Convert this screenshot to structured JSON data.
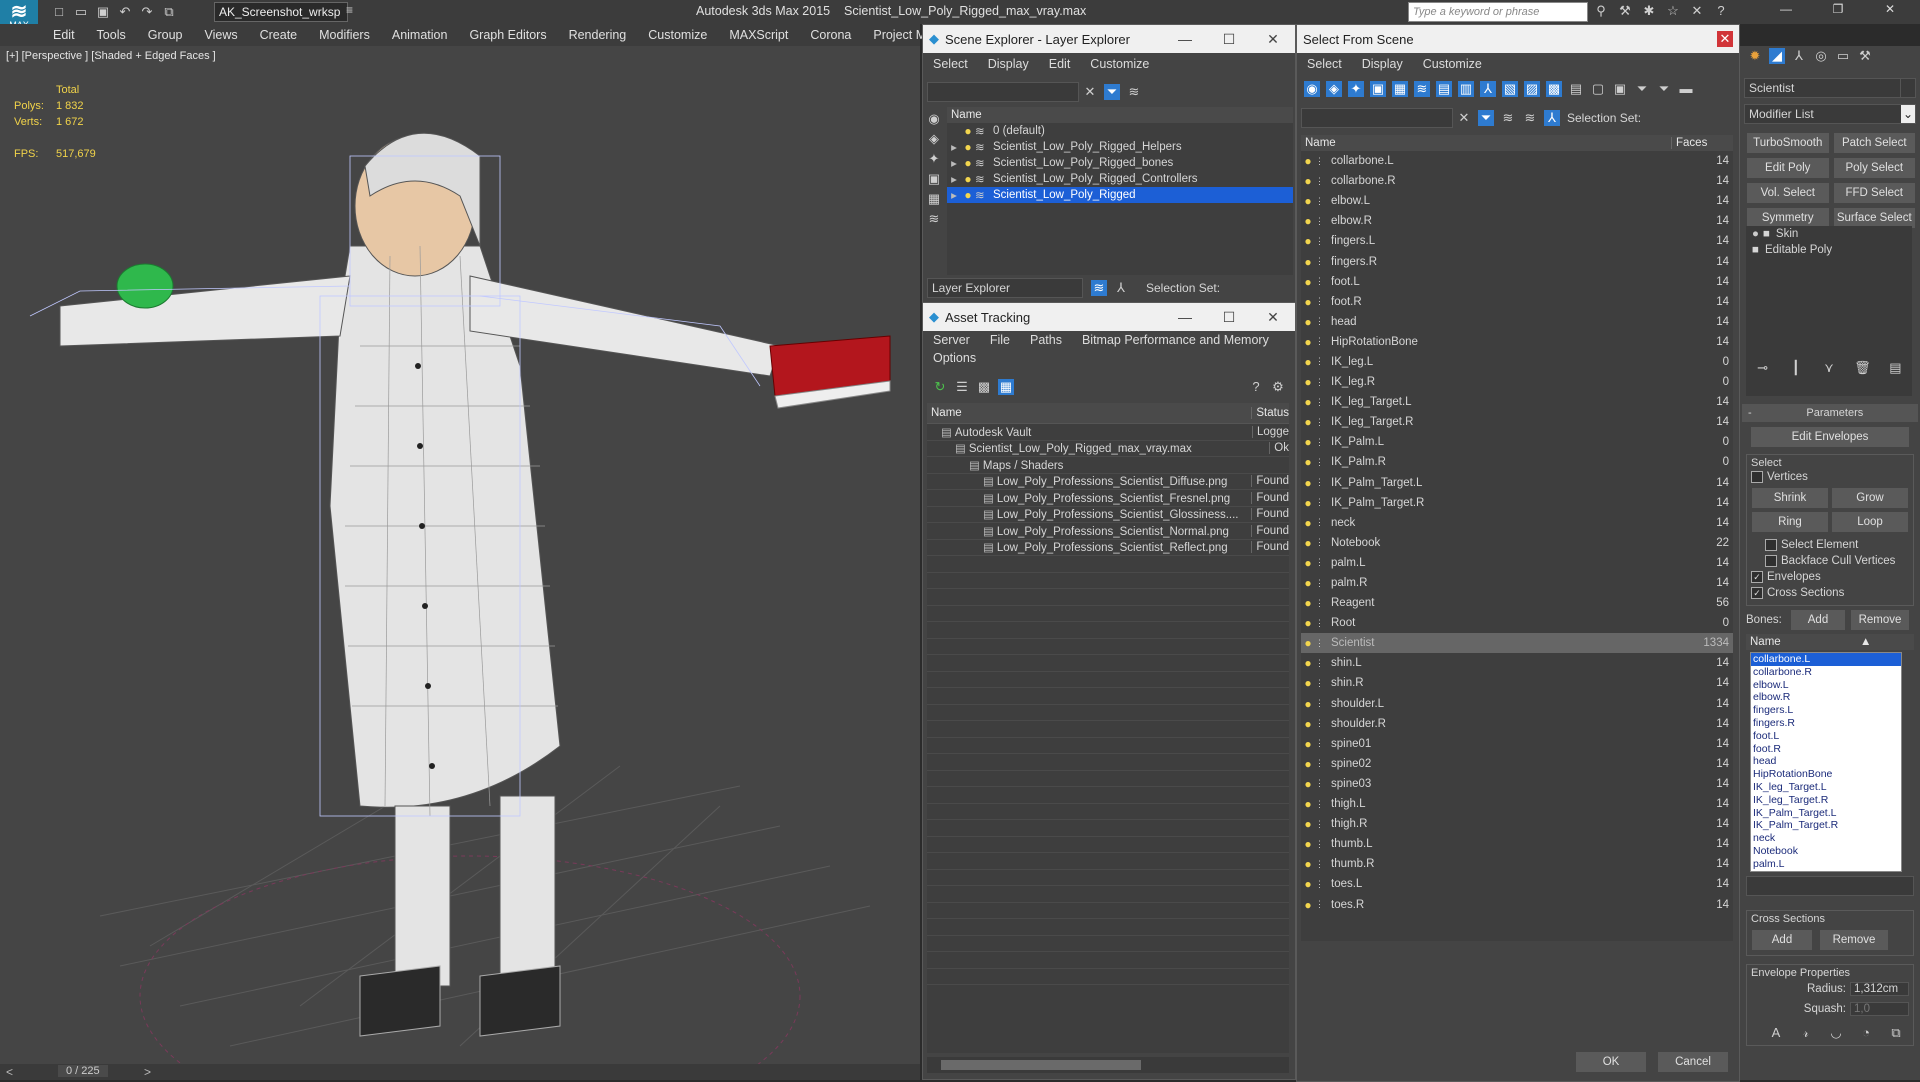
{
  "app": {
    "title": "Autodesk 3ds Max  2015",
    "file_title": "Scientist_Low_Poly_Rigged_max_vray.max",
    "workspace": "AK_Screenshot_wrksp",
    "search_placeholder": "Type a keyword or phrase",
    "logo": "MAX"
  },
  "menu": [
    "Edit",
    "Tools",
    "Group",
    "Views",
    "Create",
    "Modifiers",
    "Animation",
    "Graph Editors",
    "Rendering",
    "Customize",
    "MAXScript",
    "Corona",
    "Project Man"
  ],
  "viewport": {
    "label": "[+] [Perspective ] [Shaded + Edged Faces ]",
    "stats_total": "Total",
    "polys_label": "Polys:",
    "polys_value": "1 832",
    "verts_label": "Verts:",
    "verts_value": "1 672",
    "fps_label": "FPS:",
    "fps_value": "517,679",
    "timeline": "0 / 225"
  },
  "scene_explorer": {
    "title": "Scene Explorer - Layer Explorer",
    "menu": [
      "Select",
      "Display",
      "Edit",
      "Customize"
    ],
    "col_name": "Name",
    "layers": [
      "0 (default)",
      "Scientist_Low_Poly_Rigged_Helpers",
      "Scientist_Low_Poly_Rigged_bones",
      "Scientist_Low_Poly_Rigged_Controllers",
      "Scientist_Low_Poly_Rigged"
    ],
    "selected_index": 4,
    "footer_dropdown": "Layer Explorer",
    "selection_set": "Selection Set:"
  },
  "asset_tracking": {
    "title": "Asset Tracking",
    "menu1": [
      "Server",
      "File",
      "Paths",
      "Bitmap Performance and Memory"
    ],
    "menu2": [
      "Options"
    ],
    "col_name": "Name",
    "col_status": "Status",
    "rows": [
      {
        "name": "Autodesk Vault",
        "status": "Logge",
        "indent": 1
      },
      {
        "name": "Scientist_Low_Poly_Rigged_max_vray.max",
        "status": "Ok",
        "indent": 2
      },
      {
        "name": "Maps / Shaders",
        "status": "",
        "indent": 3
      },
      {
        "name": "Low_Poly_Professions_Scientist_Diffuse.png",
        "status": "Found",
        "indent": 4
      },
      {
        "name": "Low_Poly_Professions_Scientist_Fresnel.png",
        "status": "Found",
        "indent": 4
      },
      {
        "name": "Low_Poly_Professions_Scientist_Glossiness....",
        "status": "Found",
        "indent": 4
      },
      {
        "name": "Low_Poly_Professions_Scientist_Normal.png",
        "status": "Found",
        "indent": 4
      },
      {
        "name": "Low_Poly_Professions_Scientist_Reflect.png",
        "status": "Found",
        "indent": 4
      }
    ]
  },
  "select_from_scene": {
    "title": "Select From Scene",
    "menu": [
      "Select",
      "Display",
      "Customize"
    ],
    "selection_set": "Selection Set:",
    "col_name": "Name",
    "col_faces": "Faces",
    "selected_name": "Scientist",
    "rows": [
      [
        "collarbone.L",
        "14"
      ],
      [
        "collarbone.R",
        "14"
      ],
      [
        "elbow.L",
        "14"
      ],
      [
        "elbow.R",
        "14"
      ],
      [
        "fingers.L",
        "14"
      ],
      [
        "fingers.R",
        "14"
      ],
      [
        "foot.L",
        "14"
      ],
      [
        "foot.R",
        "14"
      ],
      [
        "head",
        "14"
      ],
      [
        "HipRotationBone",
        "14"
      ],
      [
        "IK_leg.L",
        "0"
      ],
      [
        "IK_leg.R",
        "0"
      ],
      [
        "IK_leg_Target.L",
        "14"
      ],
      [
        "IK_leg_Target.R",
        "14"
      ],
      [
        "IK_Palm.L",
        "0"
      ],
      [
        "IK_Palm.R",
        "0"
      ],
      [
        "IK_Palm_Target.L",
        "14"
      ],
      [
        "IK_Palm_Target.R",
        "14"
      ],
      [
        "neck",
        "14"
      ],
      [
        "Notebook",
        "22"
      ],
      [
        "palm.L",
        "14"
      ],
      [
        "palm.R",
        "14"
      ],
      [
        "Reagent",
        "56"
      ],
      [
        "Root",
        "0"
      ],
      [
        "Scientist",
        "1334"
      ],
      [
        "shin.L",
        "14"
      ],
      [
        "shin.R",
        "14"
      ],
      [
        "shoulder.L",
        "14"
      ],
      [
        "shoulder.R",
        "14"
      ],
      [
        "spine01",
        "14"
      ],
      [
        "spine02",
        "14"
      ],
      [
        "spine03",
        "14"
      ],
      [
        "thigh.L",
        "14"
      ],
      [
        "thigh.R",
        "14"
      ],
      [
        "thumb.L",
        "14"
      ],
      [
        "thumb.R",
        "14"
      ],
      [
        "toes.L",
        "14"
      ],
      [
        "toes.R",
        "14"
      ]
    ],
    "ok": "OK",
    "cancel": "Cancel"
  },
  "command_panel": {
    "object_name": "Scientist",
    "modifier_list": "Modifier List",
    "mod_buttons": [
      "TurboSmooth",
      "Patch Select",
      "Edit Poly",
      "Poly Select",
      "Vol. Select",
      "FFD Select",
      "Symmetry",
      "Surface Select"
    ],
    "stack": [
      "Skin",
      "Editable Poly"
    ],
    "parameters": "Parameters",
    "edit_envelopes": "Edit Envelopes",
    "select_group": "Select",
    "vertices": "Vertices",
    "shrink": "Shrink",
    "grow": "Grow",
    "ring": "Ring",
    "loop": "Loop",
    "select_element": "Select Element",
    "backface": "Backface Cull Vertices",
    "envelopes": "Envelopes",
    "cross_sections": "Cross Sections",
    "bones_label": "Bones:",
    "add": "Add",
    "remove": "Remove",
    "bones_col": "Name",
    "bones": [
      "collarbone.L",
      "collarbone.R",
      "elbow.L",
      "elbow.R",
      "fingers.L",
      "fingers.R",
      "foot.L",
      "foot.R",
      "head",
      "HipRotationBone",
      "IK_leg_Target.L",
      "IK_leg_Target.R",
      "IK_Palm_Target.L",
      "IK_Palm_Target.R",
      "neck",
      "Notebook",
      "palm.L"
    ],
    "cross_sections_group": "Cross Sections",
    "envelope_props": "Envelope Properties",
    "radius_label": "Radius:",
    "radius_value": "1,312cm",
    "squash_label": "Squash:",
    "squash_value": "1,0"
  },
  "colors": {
    "selection": "#1c5fd6",
    "bulb": "#f3d64e",
    "accent": "#2e7bd0"
  }
}
